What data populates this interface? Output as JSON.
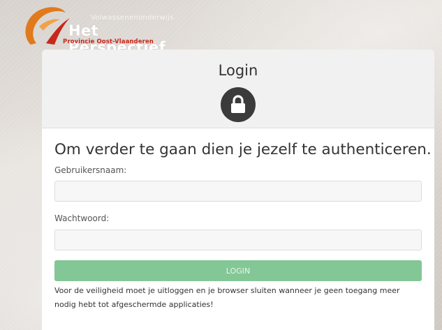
{
  "brand": {
    "tagline": "Volwassenenonderwijs",
    "name": "Het Perspectief",
    "region": "Provincie Oost-Vlaanderen",
    "colors": {
      "swoosh": "#e07a1d",
      "accent": "#c8281c"
    }
  },
  "login_card": {
    "title": "Login",
    "icon": "lock-icon",
    "heading": "Om verder te gaan dien je jezelf te authenticeren.",
    "username": {
      "label": "Gebruikersnaam:",
      "value": "",
      "placeholder": ""
    },
    "password": {
      "label": "Wachtwoord:",
      "value": "",
      "placeholder": ""
    },
    "submit_label": "LOGIN",
    "notice": "Voor de veiligheid moet je uitloggen en je browser sluiten wanneer je geen toegang meer nodig hebt tot afgeschermde applicaties!",
    "colors": {
      "submit_bg": "#83c796",
      "lock_badge": "#3b3b3b"
    }
  }
}
